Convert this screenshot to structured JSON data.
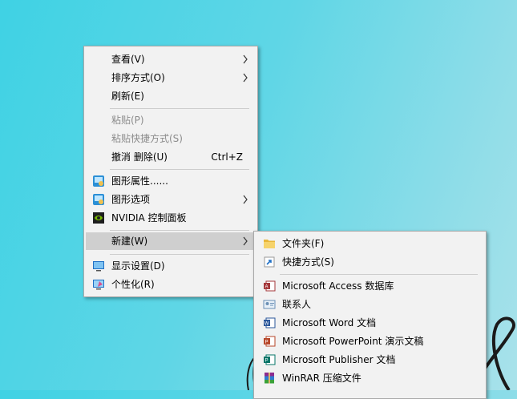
{
  "context_menu": {
    "items": [
      {
        "label": "查看(V)",
        "has_submenu": true
      },
      {
        "label": "排序方式(O)",
        "has_submenu": true
      },
      {
        "label": "刷新(E)"
      },
      {
        "label": "粘贴(P)",
        "disabled": true
      },
      {
        "label": "粘贴快捷方式(S)",
        "disabled": true
      },
      {
        "label": "撤消 删除(U)",
        "shortcut": "Ctrl+Z"
      },
      {
        "label": "图形属性......",
        "icon": "intel-graphics-icon"
      },
      {
        "label": "图形选项",
        "icon": "intel-graphics-icon",
        "has_submenu": true
      },
      {
        "label": "NVIDIA 控制面板",
        "icon": "nvidia-icon"
      },
      {
        "label": "新建(W)",
        "has_submenu": true,
        "highlighted": true
      },
      {
        "label": "显示设置(D)",
        "icon": "display-icon"
      },
      {
        "label": "个性化(R)",
        "icon": "personalize-icon"
      }
    ]
  },
  "new_submenu": {
    "items": [
      {
        "label": "文件夹(F)",
        "icon": "folder-icon"
      },
      {
        "label": "快捷方式(S)",
        "icon": "shortcut-icon"
      },
      {
        "label": "Microsoft Access 数据库",
        "icon": "access-icon"
      },
      {
        "label": "联系人",
        "icon": "contact-icon"
      },
      {
        "label": "Microsoft Word 文档",
        "icon": "word-icon"
      },
      {
        "label": "Microsoft PowerPoint 演示文稿",
        "icon": "powerpoint-icon"
      },
      {
        "label": "Microsoft Publisher 文档",
        "icon": "publisher-icon"
      },
      {
        "label": "WinRAR 压缩文件",
        "icon": "winrar-icon"
      }
    ]
  },
  "colors": {
    "desktop_left": "#3fd2e4",
    "desktop_right": "#a9e2ea",
    "menu_bg": "#f2f2f2",
    "highlight": "#cfcfcf",
    "disabled_text": "#8c8c8c"
  }
}
